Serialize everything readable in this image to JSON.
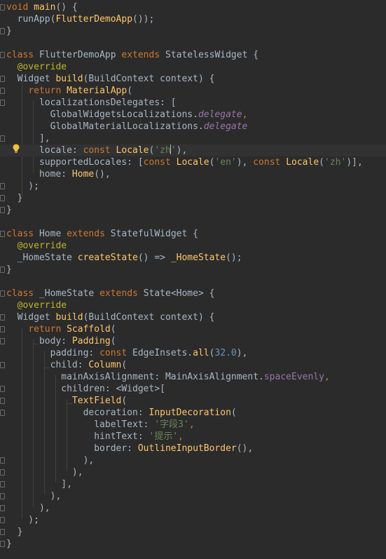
{
  "editor": {
    "lines": [
      {
        "tokens": [
          {
            "t": "void ",
            "c": "kw"
          },
          {
            "t": "main",
            "c": "fn"
          },
          {
            "t": "() {",
            "c": ""
          }
        ]
      },
      {
        "tokens": [
          {
            "t": "  runApp(",
            "c": ""
          },
          {
            "t": "FlutterDemoApp",
            "c": "fn"
          },
          {
            "t": "());",
            "c": ""
          }
        ]
      },
      {
        "tokens": [
          {
            "t": "}",
            "c": ""
          }
        ]
      },
      {
        "tokens": []
      },
      {
        "tokens": [
          {
            "t": "class ",
            "c": "kw"
          },
          {
            "t": "FlutterDemoApp ",
            "c": ""
          },
          {
            "t": "extends ",
            "c": "kw"
          },
          {
            "t": "StatelessWidget {",
            "c": ""
          }
        ]
      },
      {
        "tokens": [
          {
            "t": "  @override",
            "c": "ann"
          }
        ]
      },
      {
        "tokens": [
          {
            "t": "  Widget ",
            "c": ""
          },
          {
            "t": "build",
            "c": "fn"
          },
          {
            "t": "(BuildContext context) {",
            "c": ""
          }
        ]
      },
      {
        "tokens": [
          {
            "t": "    ",
            "c": ""
          },
          {
            "t": "return ",
            "c": "kw"
          },
          {
            "t": "MaterialApp",
            "c": "fn"
          },
          {
            "t": "(",
            "c": ""
          }
        ]
      },
      {
        "tokens": [
          {
            "t": "      localizationsDelegates: [",
            "c": ""
          }
        ]
      },
      {
        "tokens": [
          {
            "t": "        GlobalWidgetsLocalizations.",
            "c": ""
          },
          {
            "t": "delegate",
            "c": "it"
          },
          {
            "t": ",",
            "c": "kw"
          }
        ]
      },
      {
        "tokens": [
          {
            "t": "        GlobalMaterialLocalizations.",
            "c": ""
          },
          {
            "t": "delegate",
            "c": "it"
          }
        ]
      },
      {
        "tokens": [
          {
            "t": "      ],",
            "c": ""
          }
        ]
      },
      {
        "tokens": [
          {
            "t": "      locale: ",
            "c": ""
          },
          {
            "t": "const ",
            "c": "kw"
          },
          {
            "t": "Locale",
            "c": "fn"
          },
          {
            "t": "(",
            "c": ""
          },
          {
            "t": "'zh",
            "c": "str"
          },
          {
            "t": "CARET",
            "c": "caret"
          },
          {
            "t": "'",
            "c": "str"
          },
          {
            "t": "),",
            "c": ""
          }
        ]
      },
      {
        "tokens": [
          {
            "t": "      supportedLocales: [",
            "c": ""
          },
          {
            "t": "const ",
            "c": "kw"
          },
          {
            "t": "Locale",
            "c": "fn"
          },
          {
            "t": "(",
            "c": ""
          },
          {
            "t": "'en'",
            "c": "str"
          },
          {
            "t": "), ",
            "c": ""
          },
          {
            "t": "const ",
            "c": "kw"
          },
          {
            "t": "Locale",
            "c": "fn"
          },
          {
            "t": "(",
            "c": ""
          },
          {
            "t": "'zh'",
            "c": "str"
          },
          {
            "t": ")],",
            "c": ""
          }
        ]
      },
      {
        "tokens": [
          {
            "t": "      home: ",
            "c": ""
          },
          {
            "t": "Home",
            "c": "fn"
          },
          {
            "t": "(),",
            "c": ""
          }
        ]
      },
      {
        "tokens": [
          {
            "t": "    );",
            "c": ""
          }
        ]
      },
      {
        "tokens": [
          {
            "t": "  }",
            "c": ""
          }
        ]
      },
      {
        "tokens": [
          {
            "t": "}",
            "c": ""
          }
        ]
      },
      {
        "tokens": []
      },
      {
        "tokens": [
          {
            "t": "class ",
            "c": "kw"
          },
          {
            "t": "Home ",
            "c": ""
          },
          {
            "t": "extends ",
            "c": "kw"
          },
          {
            "t": "StatefulWidget {",
            "c": ""
          }
        ]
      },
      {
        "tokens": [
          {
            "t": "  @override",
            "c": "ann"
          }
        ]
      },
      {
        "tokens": [
          {
            "t": "  _HomeState ",
            "c": ""
          },
          {
            "t": "createState",
            "c": "fn"
          },
          {
            "t": "() => ",
            "c": ""
          },
          {
            "t": "_HomeState",
            "c": "fn"
          },
          {
            "t": "();",
            "c": ""
          }
        ]
      },
      {
        "tokens": [
          {
            "t": "}",
            "c": ""
          }
        ]
      },
      {
        "tokens": []
      },
      {
        "tokens": [
          {
            "t": "class ",
            "c": "kw"
          },
          {
            "t": "_HomeState ",
            "c": ""
          },
          {
            "t": "extends ",
            "c": "kw"
          },
          {
            "t": "State<Home> {",
            "c": ""
          }
        ]
      },
      {
        "tokens": [
          {
            "t": "  @override",
            "c": "ann"
          }
        ]
      },
      {
        "tokens": [
          {
            "t": "  Widget ",
            "c": ""
          },
          {
            "t": "build",
            "c": "fn"
          },
          {
            "t": "(BuildContext context) {",
            "c": ""
          }
        ]
      },
      {
        "tokens": [
          {
            "t": "    ",
            "c": ""
          },
          {
            "t": "return ",
            "c": "kw"
          },
          {
            "t": "Scaffold",
            "c": "fn"
          },
          {
            "t": "(",
            "c": ""
          }
        ]
      },
      {
        "tokens": [
          {
            "t": "      body: ",
            "c": ""
          },
          {
            "t": "Padding",
            "c": "fn"
          },
          {
            "t": "(",
            "c": ""
          }
        ]
      },
      {
        "tokens": [
          {
            "t": "        padding: ",
            "c": ""
          },
          {
            "t": "const ",
            "c": "kw"
          },
          {
            "t": "EdgeInsets.",
            "c": ""
          },
          {
            "t": "all",
            "c": "fn"
          },
          {
            "t": "(",
            "c": ""
          },
          {
            "t": "32.0",
            "c": "num"
          },
          {
            "t": "),",
            "c": ""
          }
        ]
      },
      {
        "tokens": [
          {
            "t": "        child: ",
            "c": ""
          },
          {
            "t": "Column",
            "c": "fn"
          },
          {
            "t": "(",
            "c": ""
          }
        ]
      },
      {
        "tokens": [
          {
            "t": "          mainAxisAlignment: MainAxisAlignment.",
            "c": ""
          },
          {
            "t": "spaceEvenly",
            "c": "fld"
          },
          {
            "t": ",",
            "c": "kw"
          }
        ]
      },
      {
        "tokens": [
          {
            "t": "          children: <Widget>[",
            "c": ""
          }
        ]
      },
      {
        "tokens": [
          {
            "t": "            ",
            "c": ""
          },
          {
            "t": "TextField",
            "c": "fn"
          },
          {
            "t": "(",
            "c": ""
          }
        ]
      },
      {
        "tokens": [
          {
            "t": "              decoration: ",
            "c": ""
          },
          {
            "t": "InputDecoration",
            "c": "fn"
          },
          {
            "t": "(",
            "c": ""
          }
        ]
      },
      {
        "tokens": [
          {
            "t": "                labelText: ",
            "c": ""
          },
          {
            "t": "'字段3'",
            "c": "str"
          },
          {
            "t": ",",
            "c": "kw"
          }
        ]
      },
      {
        "tokens": [
          {
            "t": "                hintText: ",
            "c": ""
          },
          {
            "t": "'提示'",
            "c": "str"
          },
          {
            "t": ",",
            "c": "kw"
          }
        ]
      },
      {
        "tokens": [
          {
            "t": "                border: ",
            "c": ""
          },
          {
            "t": "OutlineInputBorder",
            "c": "fn"
          },
          {
            "t": "(),",
            "c": ""
          }
        ]
      },
      {
        "tokens": [
          {
            "t": "              ),",
            "c": ""
          }
        ]
      },
      {
        "tokens": [
          {
            "t": "            ),",
            "c": ""
          }
        ]
      },
      {
        "tokens": [
          {
            "t": "          ],",
            "c": ""
          }
        ]
      },
      {
        "tokens": [
          {
            "t": "        ),",
            "c": ""
          }
        ]
      },
      {
        "tokens": [
          {
            "t": "      ),",
            "c": ""
          }
        ]
      },
      {
        "tokens": [
          {
            "t": "    );",
            "c": ""
          }
        ]
      },
      {
        "tokens": [
          {
            "t": "  }",
            "c": ""
          }
        ]
      },
      {
        "tokens": [
          {
            "t": "}",
            "c": ""
          }
        ]
      }
    ],
    "current_line": 12,
    "fold_markers": [
      0,
      2,
      4,
      6,
      7,
      8,
      11,
      15,
      16,
      17,
      19,
      22,
      24,
      26,
      27,
      28,
      30,
      32,
      33,
      34,
      38,
      39,
      40,
      41,
      42,
      43,
      44,
      45
    ],
    "colors": {
      "background": "#2b2b2b",
      "keyword": "#cc7832",
      "function": "#ffc66d",
      "string": "#6a8759",
      "annotation": "#bbb529",
      "number": "#6897bb",
      "field": "#9876aa"
    },
    "icons": {
      "intention": "lightbulb-icon",
      "fold": "fold-marker-icon"
    }
  }
}
